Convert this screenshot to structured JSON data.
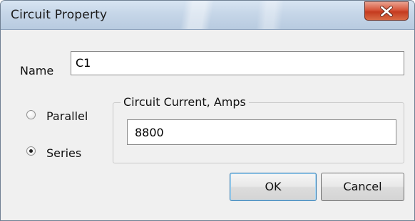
{
  "window": {
    "title": "Circuit Property"
  },
  "form": {
    "name_label": "Name",
    "name_value": "C1",
    "mode_options": [
      {
        "label": "Parallel",
        "selected": false
      },
      {
        "label": "Series",
        "selected": true
      }
    ],
    "current_group_label": "Circuit Current, Amps",
    "current_value": "8800"
  },
  "buttons": {
    "ok_label": "OK",
    "cancel_label": "Cancel"
  },
  "icons": {
    "close": "close-x-icon"
  },
  "colors": {
    "close_button": "#d6553a",
    "ok_focus_border": "#3c7fb1"
  }
}
